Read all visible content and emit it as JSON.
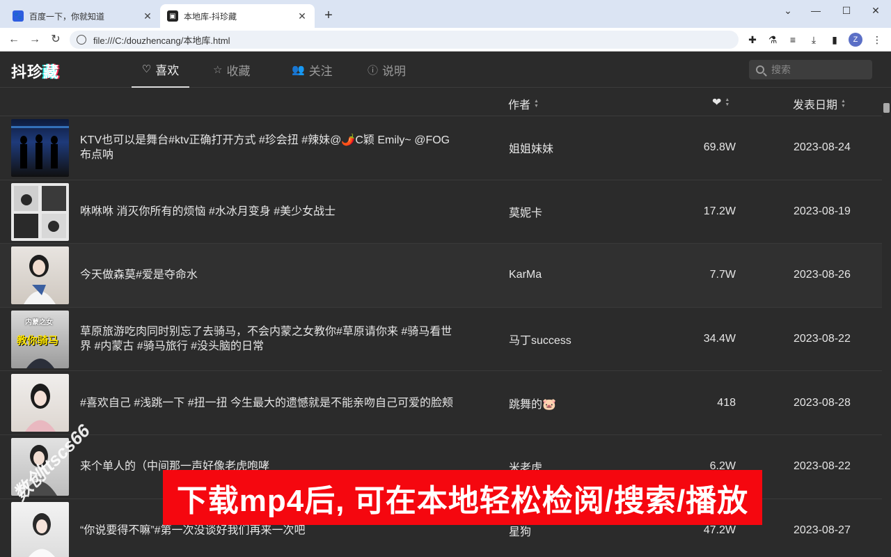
{
  "browser": {
    "tabs": [
      {
        "title": "百度一下，你就知道",
        "active": false
      },
      {
        "title": "本地库-抖珍藏",
        "active": true
      }
    ],
    "url": "file:///C:/douzhencang/本地库.html",
    "profile_initial": "Z"
  },
  "app": {
    "logo_main": "抖珍",
    "logo_accent": "藏",
    "nav": [
      {
        "label": "喜欢",
        "icon": "heart-icon",
        "active": true
      },
      {
        "label": "收藏",
        "icon": "star-icon",
        "active": false
      },
      {
        "label": "关注",
        "icon": "users-icon",
        "active": false
      },
      {
        "label": "说明",
        "icon": "info-icon",
        "active": false
      }
    ],
    "search_placeholder": "搜索"
  },
  "table": {
    "headers": {
      "author": "作者",
      "date": "发表日期"
    },
    "rows": [
      {
        "desc": "KTV也可以是舞台#ktv正确打开方式 #珍会扭 #辣妹@🌶️C颖 Emily~ @FOG 布点呐",
        "author": "姐姐妹妹",
        "likes": "69.8W",
        "date": "2023-08-24"
      },
      {
        "desc": "咻咻咻 消灭你所有的烦恼 #水冰月变身 #美少女战士",
        "author": "莫妮卡",
        "likes": "17.2W",
        "date": "2023-08-19"
      },
      {
        "desc": "今天做森莫#爱是夺命水",
        "author": "KarMa",
        "likes": "7.7W",
        "date": "2023-08-26"
      },
      {
        "desc": "草原旅游吃肉同时别忘了去骑马，不会内蒙之女教你#草原请你来 #骑马看世界 #内蒙古 #骑马旅行 #没头脑的日常",
        "author": "马丁success",
        "likes": "34.4W",
        "date": "2023-08-22"
      },
      {
        "desc": "#喜欢自己 #浅跳一下 #扭一扭 今生最大的遗憾就是不能亲吻自己可爱的脸颊",
        "author": "跳舞的🐷",
        "likes": "418",
        "date": "2023-08-28"
      },
      {
        "desc": "来个单人的（中间那一声好像老虎咆哮",
        "author": "米老虎",
        "likes": "6.2W",
        "date": "2023-08-22"
      },
      {
        "desc": "“你说要得不嘛”#第一次没谈好我们再来一次吧",
        "author": "星狗",
        "likes": "47.2W",
        "date": "2023-08-27"
      }
    ],
    "thumb_texts": {
      "row4_top": "内蒙之女",
      "row4_main": "教你骑马"
    }
  },
  "overlay": {
    "banner": "下载mp4后, 可在本地轻松检阅/搜索/播放",
    "watermark": "数创ttscs66"
  },
  "colors": {
    "banner_bg": "#f5070f",
    "app_bg": "#2b2b2b",
    "tabstrip_bg": "#dbe4f3"
  }
}
